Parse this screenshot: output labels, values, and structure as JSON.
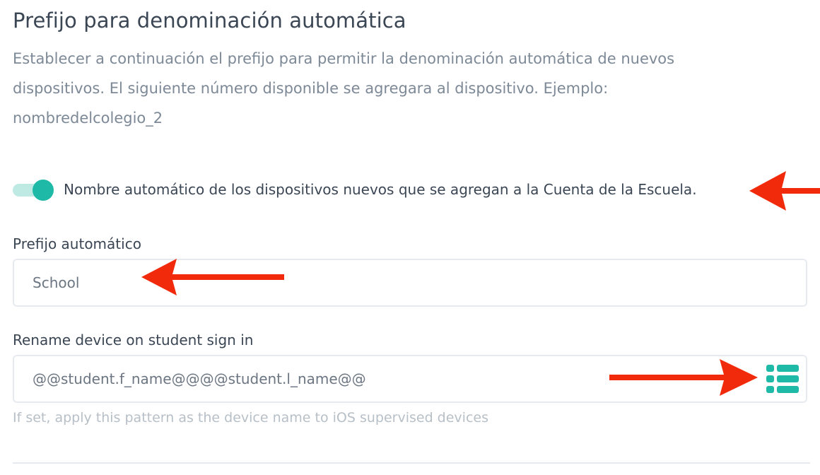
{
  "section": {
    "title": "Prefijo para denominación automática",
    "description": "Establecer a continuación el prefijo para permitir la denominación automática de nuevos dispositivos. El siguiente número disponible se agregara al dispositivo. Ejemplo: nombredelcolegio_2"
  },
  "auto_name_toggle": {
    "label": "Nombre automático de los dispositivos nuevos que se agregan a la Cuenta de la Escuela.",
    "enabled": true
  },
  "prefix_field": {
    "label": "Prefijo automático",
    "value": "School"
  },
  "rename_field": {
    "label": "Rename device on student sign in",
    "value": "@@student.f_name@@@@student.l_name@@",
    "hint": "If set, apply this pattern as the device name to iOS supervised devices",
    "icon": "list-icon"
  },
  "colors": {
    "accent": "#1fb9a8",
    "arrow": "#f22a0c"
  }
}
